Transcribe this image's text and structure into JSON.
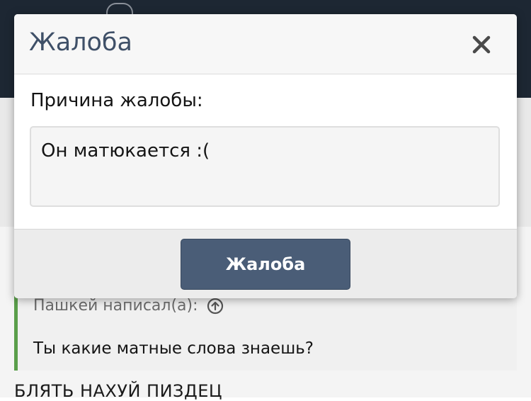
{
  "colors": {
    "header_bg": "#1d2733",
    "modal_title": "#3f5068",
    "button_bg": "#4a5d77",
    "quote_border": "#5a9e4a"
  },
  "background": {
    "quote_author": "Пашкей написал(а):",
    "quote_icon": "arrow-up-circle-icon",
    "quote_text": "Ты какие матные слова знаешь?",
    "post_text": "БЛЯТЬ НАХУЙ ПИЗДЕЦ"
  },
  "modal": {
    "title": "Жалоба",
    "close_icon": "close-icon",
    "reason_label": "Причина жалобы:",
    "reason_value": "Он матюкается :(",
    "submit_label": "Жалоба"
  }
}
